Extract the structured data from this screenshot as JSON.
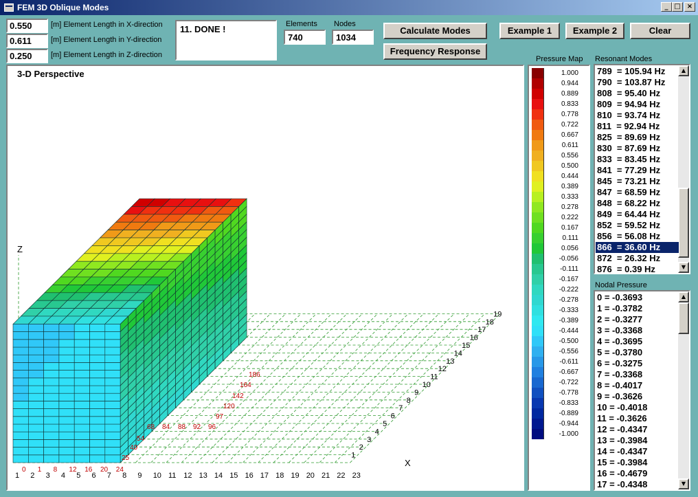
{
  "window": {
    "title": "FEM 3D Oblique Modes",
    "minimize": "_",
    "maximize": "□",
    "close": "×"
  },
  "inputs": [
    {
      "value": "0.550",
      "label": "[m] Element Length in X-direction"
    },
    {
      "value": "0.611",
      "label": "[m] Element Length in Y-direction"
    },
    {
      "value": "0.250",
      "label": "[m] Element Length in Z-direction"
    }
  ],
  "status": "11. DONE !",
  "elements": {
    "label": "Elements",
    "value": "740"
  },
  "nodes": {
    "label": "Nodes",
    "value": "1034"
  },
  "buttons": {
    "calculate": "Calculate Modes",
    "frequency": "Frequency Response",
    "example1": "Example 1",
    "example2": "Example 2",
    "clear": "Clear"
  },
  "view": {
    "title": "3-D Perspective",
    "z_axis": "Z",
    "x_axis": "X",
    "x_ticks": [
      "1",
      "2",
      "3",
      "4",
      "5",
      "6",
      "7",
      "8",
      "9",
      "10",
      "11",
      "12",
      "13",
      "14",
      "15",
      "16",
      "17",
      "18",
      "19",
      "20",
      "21",
      "22",
      "23"
    ],
    "y_ticks": [
      "1",
      "2",
      "3",
      "4",
      "5",
      "6",
      "7",
      "8",
      "9",
      "10",
      "11",
      "12",
      "13",
      "14",
      "15",
      "16",
      "17",
      "18",
      "19"
    ],
    "front_nodes": [
      "0",
      "1",
      "8",
      "12",
      "16",
      "20",
      "24"
    ],
    "right_nodes": [
      "25",
      "40",
      "54",
      "68",
      "84",
      "88",
      "92",
      "96"
    ],
    "side_nodes": [
      "97",
      "120",
      "142",
      "164",
      "186"
    ]
  },
  "pressure_map": {
    "title": "Pressure Map",
    "values": [
      "1.000",
      "0.944",
      "0.889",
      "0.833",
      "0.778",
      "0.722",
      "0.667",
      "0.611",
      "0.556",
      "0.500",
      "0.444",
      "0.389",
      "0.333",
      "0.278",
      "0.222",
      "0.167",
      "0.111",
      "0.056",
      "-0.056",
      "-0.111",
      "-0.167",
      "-0.222",
      "-0.278",
      "-0.333",
      "-0.389",
      "-0.444",
      "-0.500",
      "-0.556",
      "-0.611",
      "-0.667",
      "-0.722",
      "-0.778",
      "-0.833",
      "-0.889",
      "-0.944",
      "-1.000"
    ],
    "colors": [
      "#880000",
      "#b00000",
      "#d00000",
      "#e81010",
      "#f03010",
      "#f05a10",
      "#f07a10",
      "#f09a18",
      "#f0b020",
      "#f0c820",
      "#f0e020",
      "#e0f020",
      "#b8f020",
      "#90e820",
      "#70e020",
      "#50d820",
      "#38d030",
      "#20c838",
      "#20c070",
      "#28c890",
      "#30d0a8",
      "#30d8c0",
      "#30d8d0",
      "#30e0e0",
      "#30e8f0",
      "#30e0f8",
      "#30c8f8",
      "#30b0f0",
      "#2898e8",
      "#2080e0",
      "#1868d0",
      "#1050c0",
      "#0838b0",
      "#0028a0",
      "#001890",
      "#000c80"
    ]
  },
  "resonant_modes": {
    "title": "Resonant Modes",
    "items": [
      "789  = 105.94 Hz",
      "790  = 103.87 Hz",
      "808  = 95.40 Hz",
      "809  = 94.94 Hz",
      "810  = 93.74 Hz",
      "811  = 92.94 Hz",
      "825  = 89.69 Hz",
      "830  = 87.69 Hz",
      "833  = 83.45 Hz",
      "841  = 77.29 Hz",
      "845  = 73.21 Hz",
      "847  = 68.59 Hz",
      "848  = 68.22 Hz",
      "849  = 64.44 Hz",
      "852  = 59.52 Hz",
      "856  = 56.08 Hz",
      "866  = 36.60 Hz",
      "872  = 26.32 Hz",
      "876  = 0.39 Hz"
    ],
    "selected_index": 16
  },
  "nodal_pressure": {
    "title": "Nodal Pressure",
    "items": [
      "0 = -0.3693",
      "1 = -0.3782",
      "2 = -0.3277",
      "3 = -0.3368",
      "4 = -0.3695",
      "5 = -0.3780",
      "6 = -0.3275",
      "7 = -0.3368",
      "8 = -0.4017",
      "9 = -0.3626",
      "10 = -0.4018",
      "11 = -0.3626",
      "12 = -0.4347",
      "13 = -0.3984",
      "14 = -0.4347",
      "15 = -0.3984",
      "16 = -0.4679",
      "17 = -0.4348"
    ]
  },
  "icons": {
    "up": "scroll-up-arrow-icon",
    "down": "scroll-down-arrow-icon"
  }
}
